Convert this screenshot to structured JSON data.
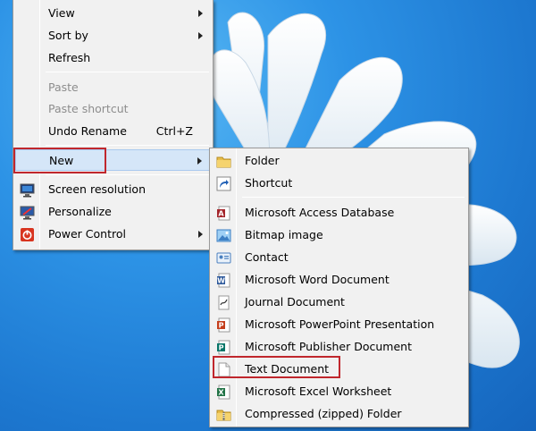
{
  "main_menu": {
    "items": [
      {
        "label": "View",
        "has_submenu": true,
        "enabled": true
      },
      {
        "label": "Sort by",
        "has_submenu": true,
        "enabled": true
      },
      {
        "label": "Refresh",
        "has_submenu": false,
        "enabled": true
      },
      {
        "label": "Paste",
        "has_submenu": false,
        "enabled": false
      },
      {
        "label": "Paste shortcut",
        "has_submenu": false,
        "enabled": false
      },
      {
        "label": "Undo Rename",
        "shortcut": "Ctrl+Z",
        "has_submenu": false,
        "enabled": true
      },
      {
        "label": "New",
        "has_submenu": true,
        "enabled": true,
        "active": true
      },
      {
        "label": "Screen resolution",
        "icon": "screen-resolution-icon",
        "enabled": true
      },
      {
        "label": "Personalize",
        "icon": "personalize-icon",
        "enabled": true
      },
      {
        "label": "Power Control",
        "icon": "power-control-icon",
        "has_submenu": true,
        "enabled": true
      }
    ]
  },
  "new_submenu": {
    "items": [
      {
        "label": "Folder",
        "icon": "folder-icon"
      },
      {
        "label": "Shortcut",
        "icon": "shortcut-icon"
      },
      {
        "label": "Microsoft Access Database",
        "icon": "access-icon"
      },
      {
        "label": "Bitmap image",
        "icon": "bitmap-icon"
      },
      {
        "label": "Contact",
        "icon": "contact-icon"
      },
      {
        "label": "Microsoft Word Document",
        "icon": "word-icon"
      },
      {
        "label": "Journal Document",
        "icon": "journal-icon"
      },
      {
        "label": "Microsoft PowerPoint Presentation",
        "icon": "powerpoint-icon"
      },
      {
        "label": "Microsoft Publisher Document",
        "icon": "publisher-icon"
      },
      {
        "label": "Text Document",
        "icon": "text-document-icon",
        "highlighted": true
      },
      {
        "label": "Microsoft Excel Worksheet",
        "icon": "excel-icon"
      },
      {
        "label": "Compressed (zipped) Folder",
        "icon": "zip-folder-icon"
      }
    ]
  },
  "colors": {
    "menu_background": "#f1f1f1",
    "active_item": "#d5e6f8",
    "highlight_box": "#c0272d",
    "disabled_text": "#8d8d8d",
    "desktop_blue": "#2d93e6"
  }
}
